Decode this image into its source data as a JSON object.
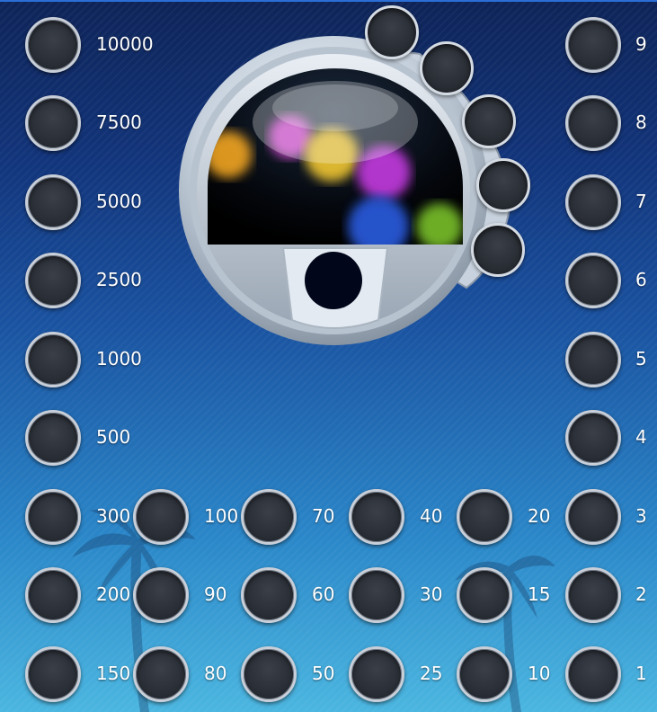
{
  "game": {
    "type": "keno-style number picker",
    "accent_color": "#c9cfd8",
    "slot_color": "#2a2e36"
  },
  "machine": {
    "ball_colors": [
      "#f2a623",
      "#d94dd6",
      "#f2c833",
      "#c43be0",
      "#2c5be0",
      "#79c02c"
    ]
  },
  "prize_column": {
    "labels": [
      "10000",
      "7500",
      "5000",
      "2500",
      "1000",
      "500",
      "300",
      "200",
      "150"
    ]
  },
  "bottom_grid": {
    "columns": [
      [
        "100",
        "90",
        "80"
      ],
      [
        "70",
        "60",
        "50"
      ],
      [
        "40",
        "30",
        "25"
      ],
      [
        "20",
        "15",
        "10"
      ]
    ]
  },
  "number_column": {
    "labels": [
      "9",
      "8",
      "7",
      "6",
      "5",
      "4",
      "3",
      "2",
      "1"
    ]
  }
}
